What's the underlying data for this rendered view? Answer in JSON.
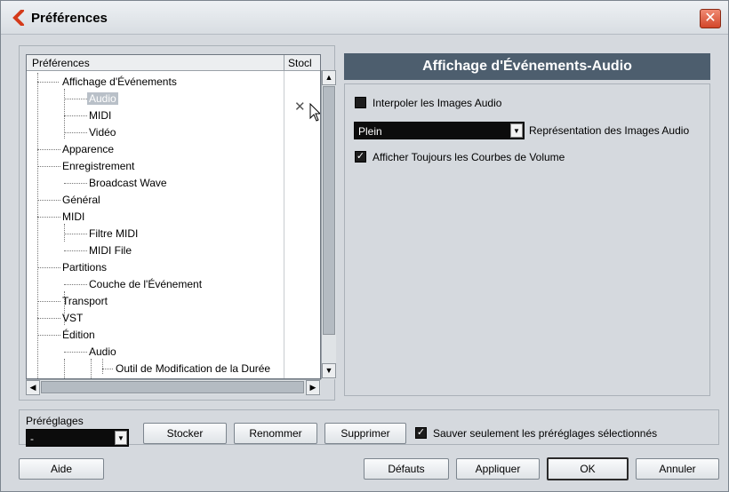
{
  "window": {
    "title": "Préférences",
    "close": "✕"
  },
  "tree": {
    "col_prefs": "Préférences",
    "col_stock": "Stocl",
    "items": [
      {
        "label": "Affichage d'Événements"
      },
      {
        "label": "Audio",
        "selected": true,
        "stocked": "✕"
      },
      {
        "label": "MIDI"
      },
      {
        "label": "Vidéo"
      },
      {
        "label": "Apparence"
      },
      {
        "label": "Enregistrement"
      },
      {
        "label": "Broadcast Wave"
      },
      {
        "label": "Général"
      },
      {
        "label": "MIDI"
      },
      {
        "label": "Filtre MIDI"
      },
      {
        "label": "MIDI File"
      },
      {
        "label": "Partitions"
      },
      {
        "label": "Couche de l'Événement"
      },
      {
        "label": "Transport"
      },
      {
        "label": "VST"
      },
      {
        "label": "Édition"
      },
      {
        "label": "Audio"
      },
      {
        "label": "Outil de Modification de la Durée"
      }
    ]
  },
  "page": {
    "title": "Affichage d'Événements-Audio",
    "interp_label": "Interpoler les Images Audio",
    "interp_checked": false,
    "repr_value": "Plein",
    "repr_label": "Représentation des Images Audio",
    "curves_label": "Afficher Toujours les Courbes de Volume",
    "curves_checked": true
  },
  "presets": {
    "label": "Préréglages",
    "value": "-",
    "store": "Stocker",
    "rename": "Renommer",
    "delete": "Supprimer",
    "save_selected_label": "Sauver seulement les préréglages sélectionnés",
    "save_selected_checked": true
  },
  "footer": {
    "help": "Aide",
    "defaults": "Défauts",
    "apply": "Appliquer",
    "ok": "OK",
    "cancel": "Annuler"
  },
  "icons": {
    "app": "cubase-logo-icon",
    "scroll_up": "▲",
    "scroll_down": "▼",
    "scroll_left": "◀",
    "scroll_right": "▶",
    "dropdown": "▼",
    "check": "✓"
  }
}
